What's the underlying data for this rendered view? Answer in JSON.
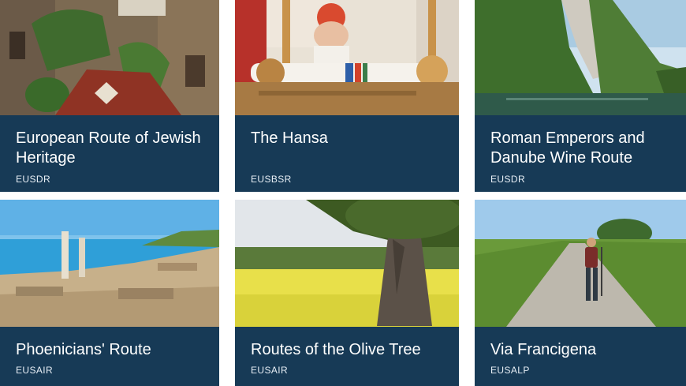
{
  "cards": [
    {
      "title": "European Route of Jewish Heritage",
      "tag": "EUSDR"
    },
    {
      "title": "The Hansa",
      "tag": "EUSBSR"
    },
    {
      "title": "Roman Emperors and Danube Wine Route",
      "tag": "EUSDR"
    },
    {
      "title": "Phoenicians' Route",
      "tag": "EUSAIR"
    },
    {
      "title": "Routes of the Olive Tree",
      "tag": "EUSAIR"
    },
    {
      "title": "Via Francigena",
      "tag": "EUSALP"
    }
  ],
  "colors": {
    "panel": "#173a56",
    "text": "#ffffff"
  }
}
